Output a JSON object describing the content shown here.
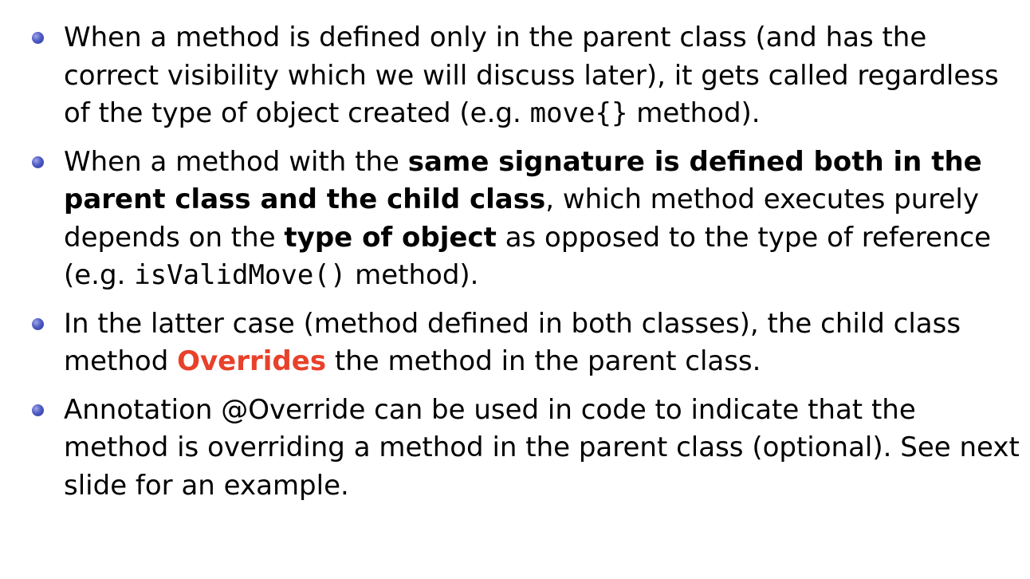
{
  "slide": {
    "bullets": [
      {
        "parts": [
          "When a method is defined only in the parent class (and has the correct visibility which we will discuss later), it gets called regardless of the type of object created (e.g. ",
          "move{}",
          " method)."
        ]
      },
      {
        "parts": [
          "When a method with the ",
          "same signature is defined both in the parent class and the child class",
          ", which method executes purely depends on the ",
          "type of object",
          " as opposed to the type of reference (e.g. ",
          "isValidMove()",
          " method)."
        ]
      },
      {
        "parts": [
          "In the latter case (method defined in both classes), the child class method ",
          "Overrides",
          " the method in the parent class."
        ]
      },
      {
        "parts": [
          "Annotation @Override can be used in code to indicate that the method is overriding a method in the parent class (optional).  See next slide for an example."
        ]
      }
    ]
  },
  "colors": {
    "bullet": "#3b47b0",
    "alert": "#e8412a",
    "text": "#000000",
    "background": "#ffffff"
  }
}
